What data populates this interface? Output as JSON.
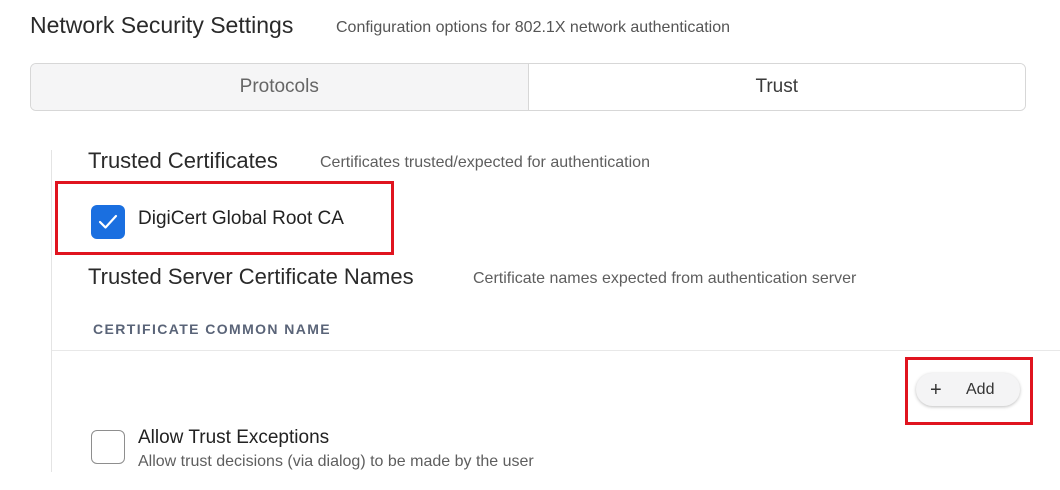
{
  "page": {
    "title": "Network Security Settings",
    "subtitle": "Configuration options for 802.1X network authentication"
  },
  "tabs": [
    {
      "label": "Protocols",
      "active": false
    },
    {
      "label": "Trust",
      "active": true
    }
  ],
  "trusted_certificates": {
    "title": "Trusted Certificates",
    "description": "Certificates trusted/expected for authentication",
    "items": [
      {
        "label": "DigiCert Global Root CA",
        "checked": true
      }
    ]
  },
  "trusted_server_names": {
    "title": "Trusted Server Certificate Names",
    "description": "Certificate names expected from authentication server",
    "column_header": "CERTIFICATE COMMON NAME",
    "rows": [],
    "add_button_label": "Add",
    "add_icon": "plus-icon"
  },
  "trust_exceptions": {
    "label": "Allow Trust Exceptions",
    "description": "Allow trust decisions (via dialog) to be made by the user",
    "checked": false
  },
  "colors": {
    "accent": "#1a6fe0",
    "highlight": "#e0141f"
  }
}
